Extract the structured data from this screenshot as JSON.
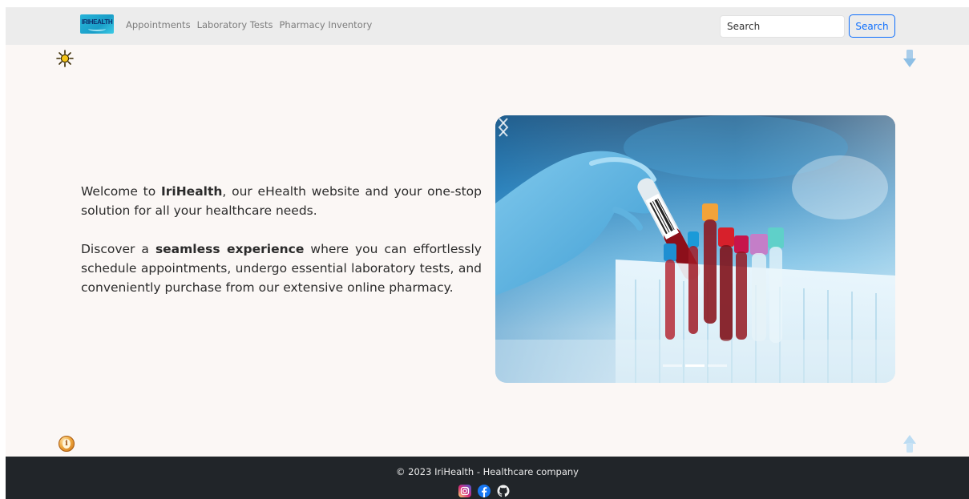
{
  "navbar": {
    "logo_text": "IRIHEALTH",
    "links": [
      {
        "label": "Appointments"
      },
      {
        "label": "Laboratory Tests"
      },
      {
        "label": "Pharmacy Inventory"
      }
    ],
    "search_placeholder": "Search",
    "search_button": "Search"
  },
  "intro": {
    "p1_before": "Welcome to ",
    "p1_brand": "IriHealth",
    "p1_after": ", our eHealth website and your one-stop solution for all your healthcare needs.",
    "p2_before": "Discover a ",
    "p2_bold": "seamless experience",
    "p2_after": " where you can effortlessly schedule appointments, undergo essential laboratory tests, and conveniently purchase from our extensive online pharmacy."
  },
  "carousel": {
    "slide_count": 3,
    "active_slide": 2,
    "image": "laboratory-blood-test-tubes"
  },
  "icons": {
    "theme": "sun-icon",
    "scroll_down": "arrow-down-icon",
    "scroll_up": "arrow-up-icon",
    "info": "info-icon",
    "social": [
      "instagram-icon",
      "facebook-icon",
      "github-icon"
    ]
  },
  "footer": {
    "copyright": "© 2023 IriHealth - Healthcare company"
  },
  "colors": {
    "accent": "#0d6efd",
    "navbar_bg": "#ececec",
    "page_bg": "#fbf7f5",
    "footer_bg": "#212529"
  }
}
